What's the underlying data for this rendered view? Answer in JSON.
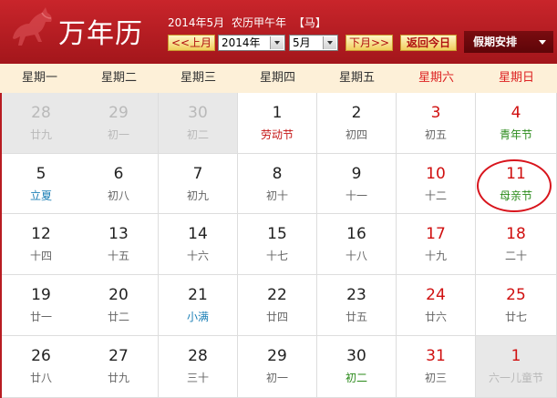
{
  "header": {
    "logo_text": "万年历",
    "info": {
      "date": "2014年5月",
      "lunar": "农历甲午年",
      "zodiac": "【马】"
    },
    "prev_month_label": "<<上月",
    "year_select": "2014年",
    "month_select": "5月",
    "next_month_label": "下月>>",
    "today_label": "返回今日",
    "holiday_label": "假期安排"
  },
  "weekdays": [
    "星期一",
    "星期二",
    "星期三",
    "星期四",
    "星期五",
    "星期六",
    "星期日"
  ],
  "days": [
    {
      "d": "28",
      "s": "廿九",
      "other": true
    },
    {
      "d": "29",
      "s": "初一",
      "other": true
    },
    {
      "d": "30",
      "s": "初二",
      "other": true
    },
    {
      "d": "1",
      "s": "劳动节",
      "kind": "fest"
    },
    {
      "d": "2",
      "s": "初四"
    },
    {
      "d": "3",
      "s": "初五"
    },
    {
      "d": "4",
      "s": "青年节",
      "kind": "grn"
    },
    {
      "d": "5",
      "s": "立夏",
      "kind": "term"
    },
    {
      "d": "6",
      "s": "初八"
    },
    {
      "d": "7",
      "s": "初九"
    },
    {
      "d": "8",
      "s": "初十"
    },
    {
      "d": "9",
      "s": "十一"
    },
    {
      "d": "10",
      "s": "十二"
    },
    {
      "d": "11",
      "s": "母亲节",
      "kind": "grn",
      "circled": true
    },
    {
      "d": "12",
      "s": "十四"
    },
    {
      "d": "13",
      "s": "十五"
    },
    {
      "d": "14",
      "s": "十六"
    },
    {
      "d": "15",
      "s": "十七"
    },
    {
      "d": "16",
      "s": "十八"
    },
    {
      "d": "17",
      "s": "十九"
    },
    {
      "d": "18",
      "s": "二十"
    },
    {
      "d": "19",
      "s": "廿一"
    },
    {
      "d": "20",
      "s": "廿二"
    },
    {
      "d": "21",
      "s": "小满",
      "kind": "term"
    },
    {
      "d": "22",
      "s": "廿四"
    },
    {
      "d": "23",
      "s": "廿五"
    },
    {
      "d": "24",
      "s": "廿六"
    },
    {
      "d": "25",
      "s": "廿七"
    },
    {
      "d": "26",
      "s": "廿八"
    },
    {
      "d": "27",
      "s": "廿九"
    },
    {
      "d": "28",
      "s": "三十"
    },
    {
      "d": "29",
      "s": "初一"
    },
    {
      "d": "30",
      "s": "初二",
      "kind": "grn"
    },
    {
      "d": "31",
      "s": "初三"
    },
    {
      "d": "1",
      "s": "六一儿童节",
      "kind": "grn",
      "other": true
    }
  ],
  "colors": {
    "brand_red": "#b81c22",
    "weekend_red": "#d01010",
    "festival_red": "#c41515",
    "festival_green": "#2a8a1a",
    "solar_term_blue": "#1b7fb6",
    "other_month_bg": "#e8e8e8"
  },
  "icons": {
    "logo": "horse-logo-icon",
    "select_arrow": "chevron-down-icon",
    "holiday_dropdown": "triangle-down-icon"
  }
}
